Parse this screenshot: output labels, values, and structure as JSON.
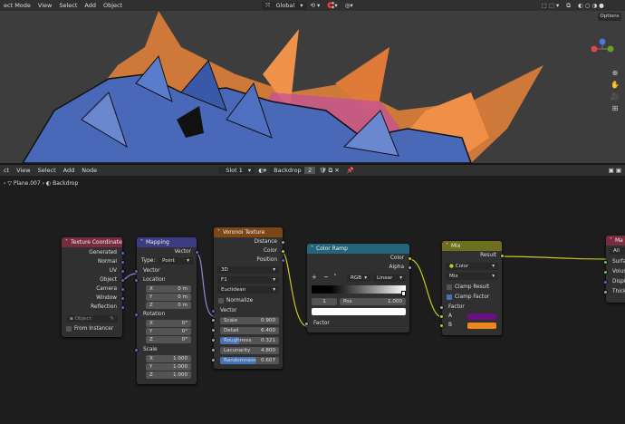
{
  "top_header": {
    "mode": "ect Mode",
    "menus": [
      "View",
      "Select",
      "Add",
      "Object"
    ],
    "orientation": "Global",
    "options_label": "Options"
  },
  "node_header": {
    "menus": [
      "ct",
      "View",
      "Select",
      "Add",
      "Node"
    ],
    "slot": "Slot 1",
    "material": "Backdrop",
    "users": "2"
  },
  "breadcrumb": {
    "object": "Plane.007",
    "material": "Backdrop"
  },
  "colors": {
    "texcoord": "#7a2c3f",
    "mapping": "#3c3c83",
    "voronoi": "#7d4616",
    "colorramp": "#24657a",
    "mix": "#6e6e1f",
    "socket_vector": "#6363c7",
    "socket_color": "#c7c729",
    "socket_float": "#a1a1a1",
    "purple": "#6a0f80",
    "orange": "#ee8620",
    "accent": "#4772b3"
  },
  "texcoord": {
    "title": "Texture Coordinate",
    "outputs": [
      "Generated",
      "Normal",
      "UV",
      "Object",
      "Camera",
      "Window",
      "Reflection"
    ],
    "object_placeholder": "Object",
    "from_instancer": "From Instancer"
  },
  "mapping": {
    "title": "Mapping",
    "output": "Vector",
    "type_label": "Type:",
    "type_value": "Point",
    "vector": "Vector",
    "location": "Location",
    "rotation": "Rotation",
    "scale": "Scale",
    "loc": [
      {
        "a": "X",
        "v": "0 m"
      },
      {
        "a": "Y",
        "v": "0 m"
      },
      {
        "a": "Z",
        "v": "0 m"
      }
    ],
    "rot": [
      {
        "a": "X",
        "v": "0°"
      },
      {
        "a": "Y",
        "v": "0°"
      },
      {
        "a": "Z",
        "v": "0°"
      }
    ],
    "scl": [
      {
        "a": "X",
        "v": "1.000"
      },
      {
        "a": "Y",
        "v": "1.000"
      },
      {
        "a": "Z",
        "v": "1.000"
      }
    ]
  },
  "voronoi": {
    "title": "Voronoi Texture",
    "outputs": [
      "Distance",
      "Color",
      "Position"
    ],
    "dim": "3D",
    "feature": "F1",
    "metric": "Euclidean",
    "normalize": "Normalize",
    "vector": "Vector",
    "inputs": [
      {
        "k": "Scale",
        "v": "0.900"
      },
      {
        "k": "Detail",
        "v": "6.400"
      },
      {
        "k": "Roughness",
        "v": "0.321"
      },
      {
        "k": "Lacunarity",
        "v": "4.800"
      },
      {
        "k": "Randomness",
        "v": "0.607"
      }
    ]
  },
  "colorramp": {
    "title": "Color Ramp",
    "outputs": [
      "Color",
      "Alpha"
    ],
    "plus": "+",
    "minus": "−",
    "mode": "RGB",
    "interp": "Linear",
    "index": "1",
    "pos_label": "Pos",
    "pos_value": "1.000",
    "factor": "Factor"
  },
  "mix": {
    "title": "Mix",
    "result": "Result",
    "dtype": "Color",
    "blend": "Mix",
    "clamp_result": "Clamp Result",
    "clamp_factor": "Clamp Factor",
    "factor": "Factor",
    "a": "A",
    "b": "B"
  },
  "output": {
    "title": "Ma",
    "target": "All",
    "inputs": [
      "Surfac",
      "Volum",
      "Displa",
      "Thickn"
    ]
  }
}
